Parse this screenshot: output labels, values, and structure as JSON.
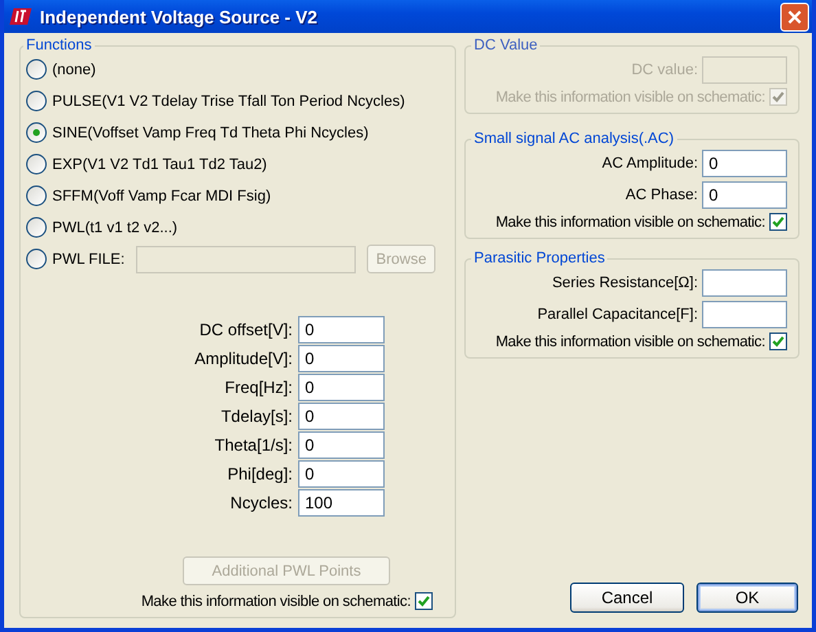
{
  "window": {
    "title": "Independent Voltage Source - V2"
  },
  "functions": {
    "legend": "Functions",
    "options": [
      {
        "kind": "plain",
        "label": "(none)",
        "selected": false
      },
      {
        "kind": "plain",
        "label": "PULSE(V1 V2 Tdelay Trise Tfall Ton Period Ncycles)",
        "selected": false
      },
      {
        "kind": "plain",
        "label": "SINE(Voffset Vamp Freq Td Theta Phi Ncycles)",
        "selected": true
      },
      {
        "kind": "plain",
        "label": "EXP(V1 V2 Td1 Tau1 Td2 Tau2)",
        "selected": false
      },
      {
        "kind": "plain",
        "label": "SFFM(Voff Vamp Fcar MDI Fsig)",
        "selected": false
      },
      {
        "kind": "plain",
        "label": "PWL(t1 v1 t2 v2...)",
        "selected": false
      },
      {
        "kind": "file",
        "label": "PWL FILE:",
        "selected": false,
        "field_disabled": true,
        "browse": {
          "label": "Browse",
          "disabled": true
        }
      }
    ],
    "params": [
      {
        "label": "DC offset[V]:",
        "value": "0"
      },
      {
        "label": "Amplitude[V]:",
        "value": "0"
      },
      {
        "label": "Freq[Hz]:",
        "value": "0"
      },
      {
        "label": "Tdelay[s]:",
        "value": "0"
      },
      {
        "label": "Theta[1/s]:",
        "value": "0"
      },
      {
        "label": "Phi[deg]:",
        "value": "0"
      },
      {
        "label": "Ncycles:",
        "value": "100"
      }
    ],
    "pwl_button": {
      "label": "Additional PWL Points",
      "disabled": true
    },
    "visible": {
      "label": "Make this information visible on schematic:",
      "checked": true,
      "disabled": false
    }
  },
  "groups": [
    {
      "legend": "DC Value",
      "disabled": true,
      "fields": [
        {
          "label": "DC value:"
        }
      ],
      "visible": {
        "label": "Make this information visible on schematic:",
        "checked": true,
        "disabled": true
      }
    },
    {
      "legend": "Small signal AC analysis(.AC)",
      "disabled": false,
      "fields": [
        {
          "label": "AC Amplitude:",
          "value": "0"
        },
        {
          "label": "AC Phase:",
          "value": "0"
        }
      ],
      "visible": {
        "label": "Make this information visible on schematic:",
        "checked": true,
        "disabled": false
      }
    },
    {
      "legend": "Parasitic Properties",
      "disabled": false,
      "fields": [
        {
          "label": "Series Resistance[Ω]:"
        },
        {
          "label": "Parallel Capacitance[F]:"
        }
      ],
      "visible": {
        "label": "Make this information visible on schematic:",
        "checked": true,
        "disabled": false
      }
    }
  ],
  "buttons": [
    {
      "label": "Cancel",
      "default": false
    },
    {
      "label": "OK",
      "default": true
    }
  ]
}
